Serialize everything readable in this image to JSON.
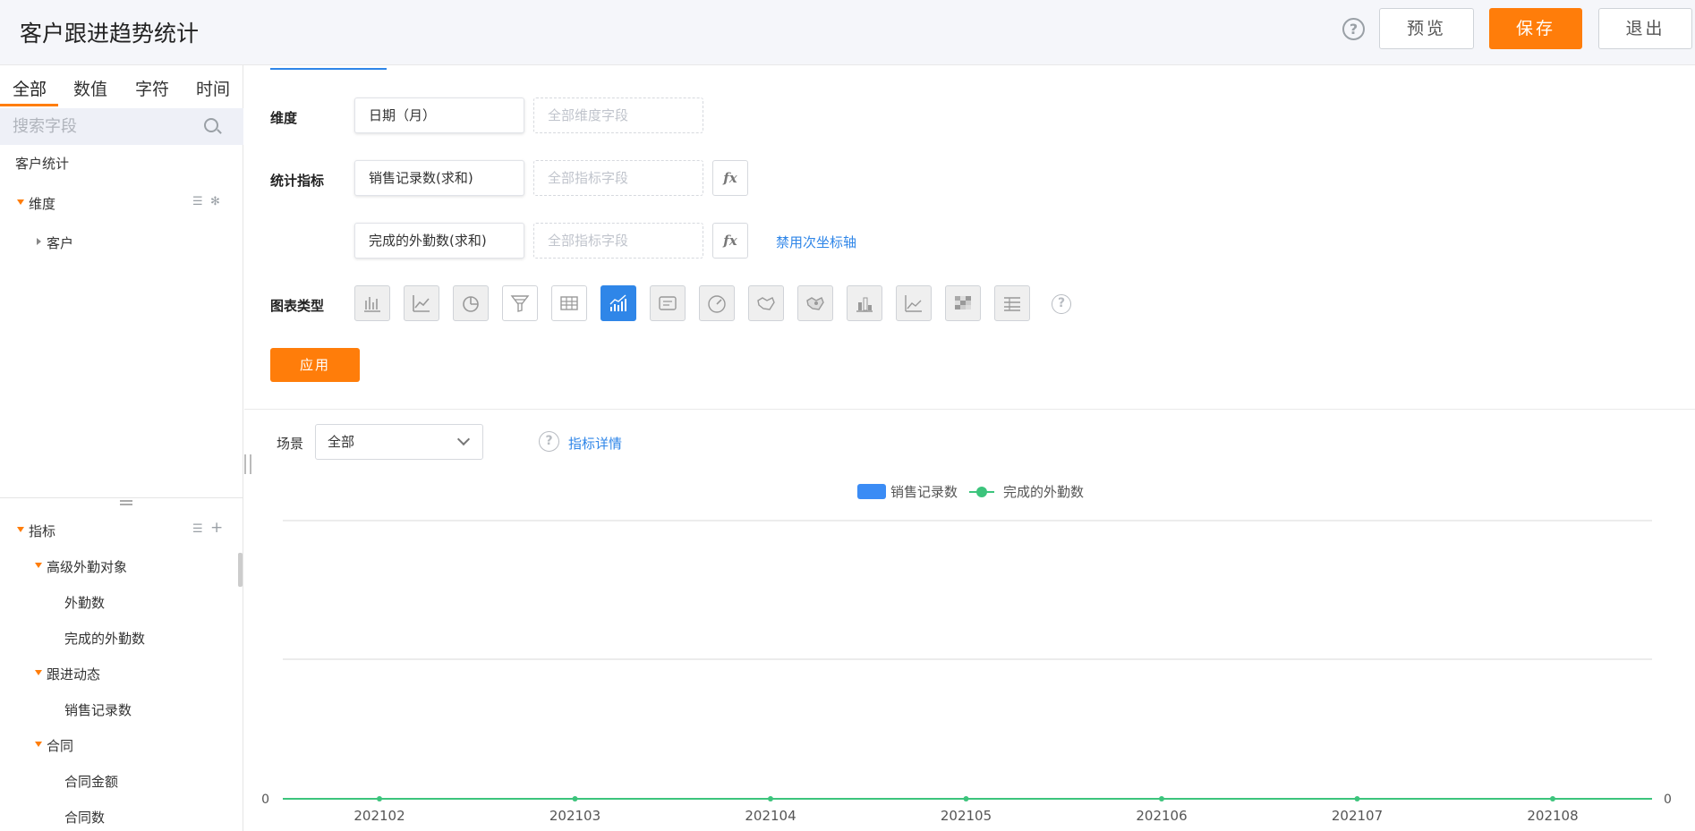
{
  "header": {
    "title": "客户跟进趋势统计",
    "help_icon": "?",
    "preview_label": "预览",
    "save_label": "保存",
    "exit_label": "退出"
  },
  "sidebar": {
    "tabs": [
      "全部",
      "数值",
      "字符",
      "时间"
    ],
    "active_tab": "全部",
    "search_placeholder": "搜索字段",
    "dataset": "客户统计",
    "dimensions_group": "维度",
    "dimension_items": [
      "客户"
    ],
    "metrics_group": "指标",
    "metric_groups": [
      {
        "name": "高级外勤对象",
        "items": [
          "外勤数",
          "完成的外勤数"
        ]
      },
      {
        "name": "跟进动态",
        "items": [
          "销售记录数"
        ]
      },
      {
        "name": "合同",
        "items": [
          "合同金额",
          "合同数"
        ]
      }
    ]
  },
  "config": {
    "dimension_label": "维度",
    "dimension_value": "日期（月）",
    "dimension_drop_placeholder": "全部维度字段",
    "metric_label": "统计指标",
    "metric_1": "销售记录数(求和)",
    "metric_2": "完成的外勤数(求和)",
    "metric_drop_placeholder": "全部指标字段",
    "fx_label": "fx",
    "secondary_axis_link": "禁用次坐标轴",
    "chart_type_label": "图表类型",
    "chart_type_help": "?",
    "apply_label": "应用"
  },
  "scene": {
    "label": "场景",
    "selected": "全部",
    "detail_link": "指标详情",
    "help_icon": "?"
  },
  "colors": {
    "accent_orange": "#ff7d0a",
    "accent_blue": "#2f86e8",
    "series_bar": "#3b8cf5",
    "series_line": "#3cc47c"
  },
  "chart_data": {
    "type": "bar",
    "categories": [
      "202102",
      "202103",
      "202104",
      "202105",
      "202106",
      "202107",
      "202108"
    ],
    "series": [
      {
        "name": "销售记录数",
        "type": "bar",
        "values": [
          0,
          0,
          0,
          0,
          0,
          0,
          0
        ]
      },
      {
        "name": "完成的外勤数",
        "type": "line",
        "values": [
          0,
          0,
          0,
          0,
          0,
          0,
          0
        ]
      }
    ],
    "y_left_tick": "0",
    "y_right_tick": "0",
    "legend_position": "top-center",
    "grid": true
  }
}
